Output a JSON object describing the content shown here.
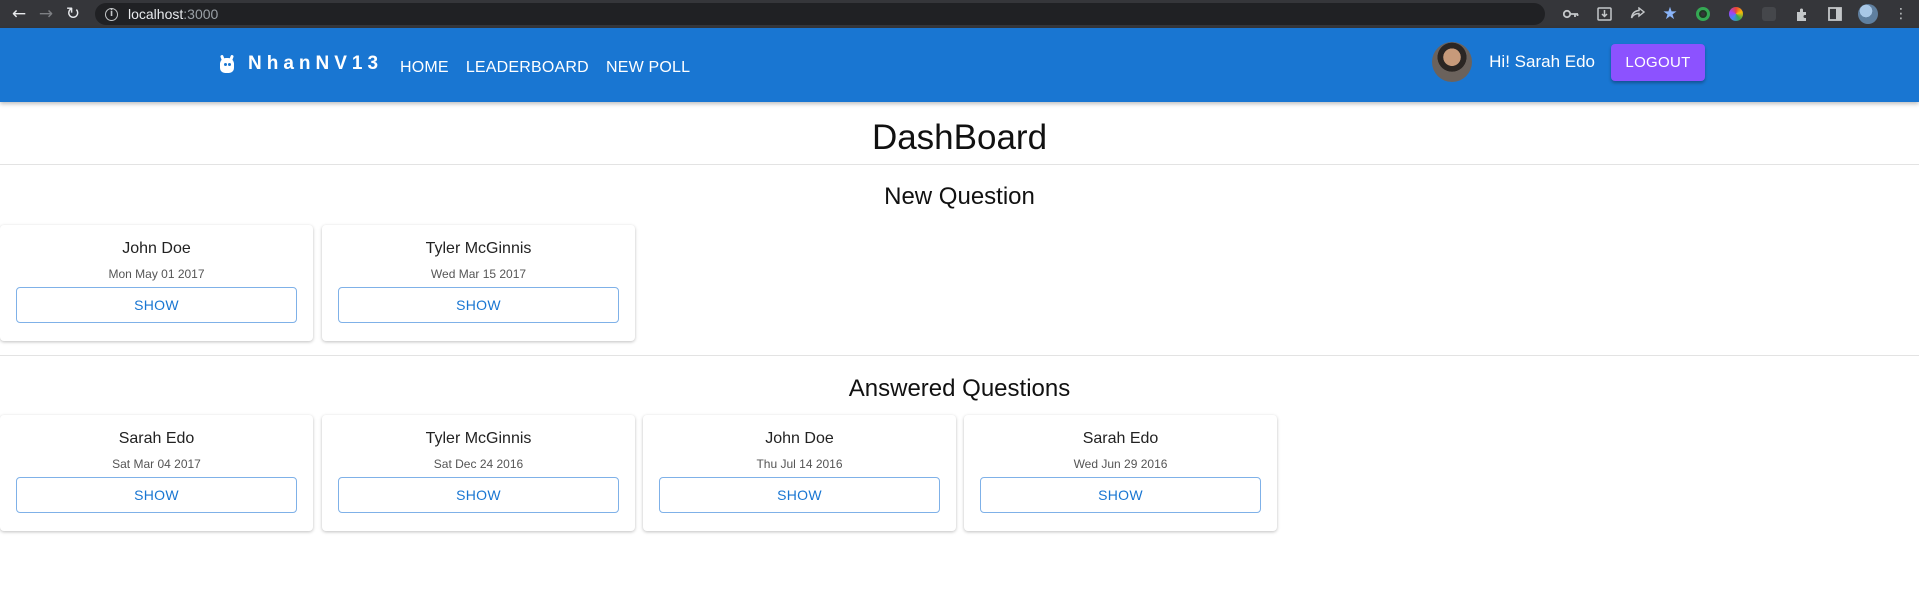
{
  "browser": {
    "url_host": "localhost",
    "url_port": ":3000",
    "icons": [
      "back-icon",
      "forward-icon",
      "reload-icon",
      "info-icon",
      "key-icon",
      "install-icon",
      "share-icon",
      "star-icon",
      "extension-icon",
      "sidepanel-icon",
      "profile-icon",
      "menu-icon"
    ]
  },
  "navbar": {
    "brand": "NhanNV13",
    "links": [
      "HOME",
      "LEADERBOARD",
      "NEW POLL"
    ],
    "greeting": "Hi! Sarah Edo",
    "logout_label": "LOGOUT",
    "bar_color": "#1976d2",
    "logout_color": "#8c52ff"
  },
  "page": {
    "title": "DashBoard"
  },
  "new_questions": {
    "title": "New Question",
    "items": [
      {
        "author": "John Doe",
        "date": "Mon May 01 2017",
        "button": "SHOW"
      },
      {
        "author": "Tyler McGinnis",
        "date": "Wed Mar 15 2017",
        "button": "SHOW"
      }
    ]
  },
  "answered_questions": {
    "title": "Answered Questions",
    "items": [
      {
        "author": "Sarah Edo",
        "date": "Sat Mar 04 2017",
        "button": "SHOW"
      },
      {
        "author": "Tyler McGinnis",
        "date": "Sat Dec 24 2016",
        "button": "SHOW"
      },
      {
        "author": "John Doe",
        "date": "Thu Jul 14 2016",
        "button": "SHOW"
      },
      {
        "author": "Sarah Edo",
        "date": "Wed Jun 29 2016",
        "button": "SHOW"
      }
    ]
  }
}
